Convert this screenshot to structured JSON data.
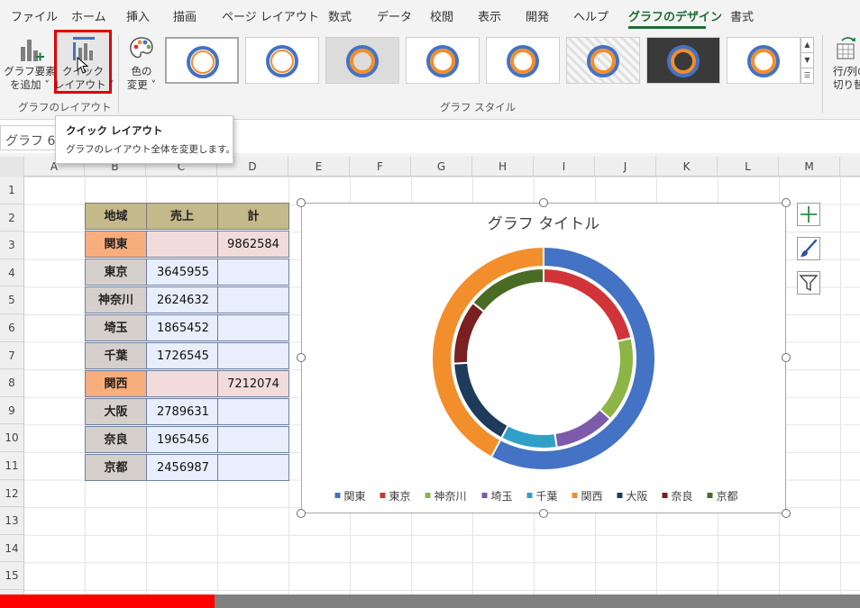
{
  "tabs": [
    "ファイル",
    "ホーム",
    "挿入",
    "描画",
    "ページ レイアウト",
    "数式",
    "データ",
    "校閲",
    "表示",
    "開発",
    "ヘルプ",
    "グラフのデザイン",
    "書式"
  ],
  "active_tab": "グラフのデザイン",
  "ribbon": {
    "add_element": [
      "グラフ要素",
      "を追加 ˅"
    ],
    "quick_layout": [
      "クイック",
      "レイアウト ˅"
    ],
    "change_color": [
      "色の",
      "変更 ˅"
    ],
    "switch_rowcol": [
      "行/列の",
      "切り替え"
    ],
    "group_layout": "グラフのレイアウト",
    "group_styles": "グラフ スタイル",
    "gallery_up_icon": "chevron-up-icon",
    "gallery_down_icon": "chevron-down-icon",
    "gallery_more_icon": "expand-gallery-icon"
  },
  "tooltip": {
    "title": "クイック レイアウト",
    "desc": "グラフのレイアウト全体を変更します。"
  },
  "name_box": "グラフ 6",
  "columns": [
    "A",
    "B",
    "C",
    "D",
    "E",
    "F",
    "G",
    "H",
    "I",
    "J",
    "K",
    "L",
    "M"
  ],
  "rows": [
    "1",
    "2",
    "3",
    "4",
    "5",
    "6",
    "7",
    "8",
    "9",
    "10",
    "11",
    "12",
    "13",
    "14",
    "15"
  ],
  "table": {
    "headers": [
      "地域",
      "売上",
      "計"
    ],
    "rows": [
      {
        "name": "関東",
        "sales": "",
        "total": "9862584"
      },
      {
        "name": "東京",
        "sales": "3645955",
        "total": ""
      },
      {
        "name": "神奈川",
        "sales": "2624632",
        "total": ""
      },
      {
        "name": "埼玉",
        "sales": "1865452",
        "total": ""
      },
      {
        "name": "千葉",
        "sales": "1726545",
        "total": ""
      },
      {
        "name": "関西",
        "sales": "",
        "total": "7212074"
      },
      {
        "name": "大阪",
        "sales": "2789631",
        "total": ""
      },
      {
        "name": "奈良",
        "sales": "1965456",
        "total": ""
      },
      {
        "name": "京都",
        "sales": "2456987",
        "total": ""
      }
    ]
  },
  "chart_data": {
    "type": "pie",
    "subtype": "doughnut",
    "title": "グラフ タイトル",
    "legend_position": "bottom",
    "categories": [
      "関東",
      "東京",
      "神奈川",
      "埼玉",
      "千葉",
      "関西",
      "大阪",
      "奈良",
      "京都"
    ],
    "colors": [
      "#4472c4",
      "#d13438",
      "#8cb545",
      "#7e5ba8",
      "#31a0c8",
      "#f28e2b",
      "#1f3b5c",
      "#7a1f22",
      "#4a6b24"
    ],
    "series": [
      {
        "values": [
          9862584,
          null,
          null,
          null,
          null,
          7212074,
          null,
          null,
          null
        ]
      },
      {
        "values": [
          null,
          3645955,
          2624632,
          1865452,
          1726545,
          null,
          2789631,
          1965456,
          2456987
        ]
      }
    ]
  },
  "chart_side_buttons": {
    "add": "plus-icon",
    "style": "brush-icon",
    "filter": "filter-icon"
  }
}
